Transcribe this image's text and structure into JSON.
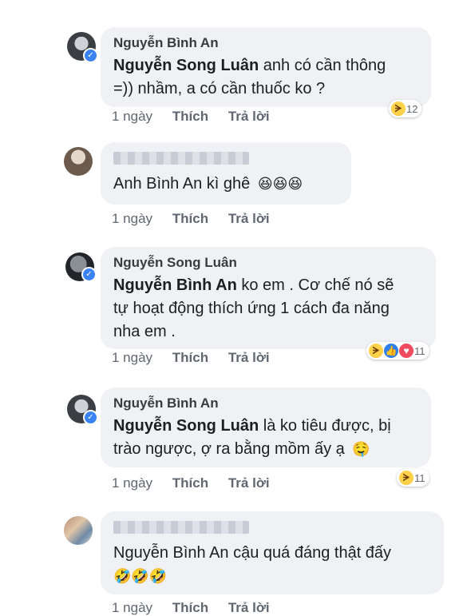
{
  "comments": [
    {
      "author": "Nguyễn Bình An",
      "mention": "Nguyễn Song Luân",
      "line1_rest": " anh có cần thông",
      "line2": "=)) nhầm, a có cần thuốc ko ?",
      "time": "1 ngày",
      "like_label": "Thích",
      "reply_label": "Trả lời",
      "reaction_count": "12",
      "reactions": [
        "haha"
      ]
    },
    {
      "author": "",
      "text": "Anh Bình An kì ghê",
      "emoji": "😆😆😆",
      "time": "1 ngày",
      "like_label": "Thích",
      "reply_label": "Trả lời"
    },
    {
      "author": "Nguyễn Song Luân",
      "mention": "Nguyễn Bình An",
      "line1_rest": " ko em . Cơ chế nó sẽ",
      "line2": "tự hoạt động thích ứng 1 cách đa năng",
      "line3": "nha em .",
      "time": "1 ngày",
      "like_label": "Thích",
      "reply_label": "Trả lời",
      "reaction_count": "11",
      "reactions": [
        "haha",
        "like",
        "love"
      ]
    },
    {
      "author": "Nguyễn Bình An",
      "mention": "Nguyễn Song Luân",
      "line1_rest": " là ko tiêu được, bị",
      "line2": "trào ngược, ợ ra bằng mồm ấy ạ",
      "emoji": "🤤",
      "time": "1 ngày",
      "like_label": "Thích",
      "reply_label": "Trả lời",
      "reaction_count": "11",
      "reactions": [
        "haha"
      ]
    },
    {
      "author": "",
      "text": "Nguyễn Bình An  cậu quá đáng thật đấy",
      "emoji": "🤣🤣🤣",
      "time": "1 ngày",
      "like_label": "Thích",
      "reply_label": "Trả lời"
    }
  ]
}
